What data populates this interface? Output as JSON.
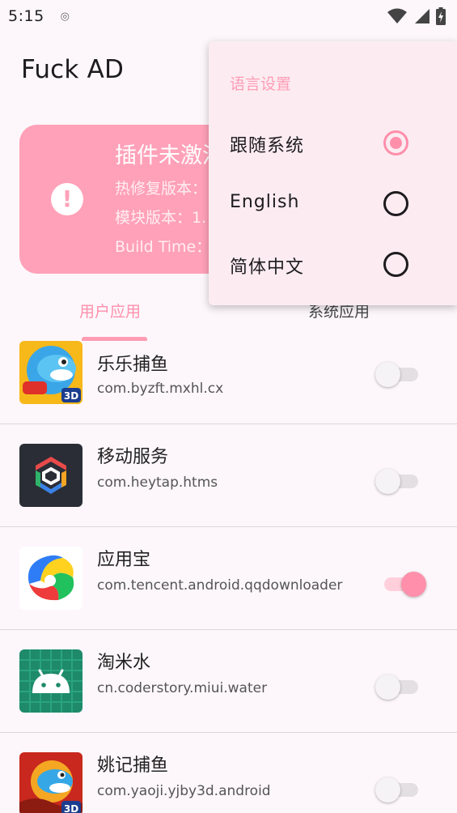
{
  "status_bar": {
    "time": "5:15",
    "notification_icon": "target-icon",
    "icons": [
      "wifi-icon",
      "signal-icon",
      "battery-icon"
    ]
  },
  "app": {
    "title": "Fuck AD"
  },
  "status_card": {
    "title": "插件未激活",
    "hotfix_label": "热修复版本：",
    "module_label": "模块版本：1.",
    "build_label": "Build Time：",
    "icon": "alert-icon",
    "color": "#ffa1b8"
  },
  "tabs": [
    {
      "label": "用户应用",
      "selected": true
    },
    {
      "label": "系统应用",
      "selected": false
    }
  ],
  "apps": [
    {
      "name": "乐乐捕鱼",
      "package": "com.byzft.mxhl.cx",
      "enabled": false,
      "icon": "fish-game-icon"
    },
    {
      "name": "移动服务",
      "package": "com.heytap.htms",
      "enabled": false,
      "icon": "mobile-services-icon"
    },
    {
      "name": "应用宝",
      "package": "com.tencent.android.qqdownloader",
      "enabled": true,
      "icon": "app-store-icon"
    },
    {
      "name": "淘米水",
      "package": "cn.coderstory.miui.water",
      "enabled": false,
      "icon": "android-icon"
    },
    {
      "name": "姚记捕鱼",
      "package": "com.yaoji.yjby3d.android",
      "enabled": false,
      "icon": "fish-game-icon"
    }
  ],
  "language_menu": {
    "header": "语言设置",
    "options": [
      {
        "label": "跟随系统",
        "selected": true
      },
      {
        "label": "English",
        "selected": false
      },
      {
        "label": "简体中文",
        "selected": false
      }
    ]
  },
  "colors": {
    "accent": "#ff8fab",
    "card": "#ffa1b8",
    "background": "#fdf7fb",
    "menu_background": "#fcecf2"
  }
}
